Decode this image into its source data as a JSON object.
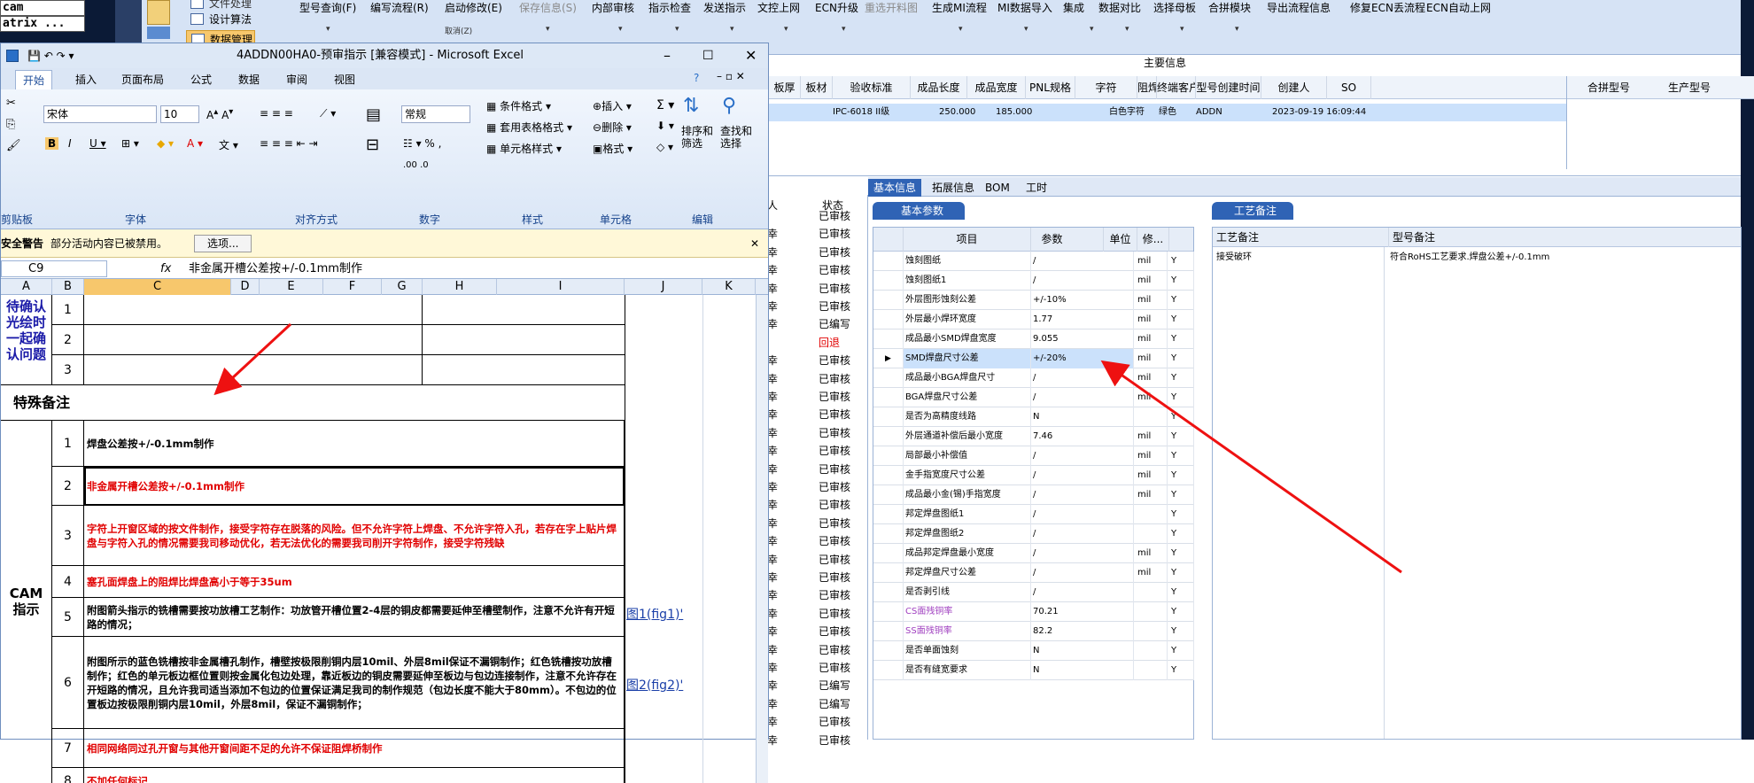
{
  "topleft": {
    "line1": "cam",
    "line2": "atrix ..."
  },
  "erp_left": {
    "top_label": "文件处理",
    "btn1": "设计算法",
    "btn2": "数据管理"
  },
  "erp_menu": [
    {
      "label": "型号查询(F)",
      "dd": "▾"
    },
    {
      "label": "编写流程(R)",
      "dd": ""
    },
    {
      "label": "启动修改(E)",
      "dd": "取消(Z)"
    },
    {
      "label": "保存信息(S)",
      "dd": "▾",
      "disabled": true
    },
    {
      "label": "内部审核",
      "dd": "▾"
    },
    {
      "label": "指示检查",
      "dd": "▾"
    },
    {
      "label": "发送指示",
      "dd": "▾"
    },
    {
      "label": "文控上网",
      "dd": "▾"
    },
    {
      "label": "ECN升级",
      "dd": "▾"
    },
    {
      "label": "重选开料图",
      "dd": "",
      "disabled": true
    },
    {
      "label": "生成MI流程",
      "dd": "▾"
    },
    {
      "label": "MI数据导入",
      "dd": "▾"
    },
    {
      "label": "集成",
      "dd": "▾"
    },
    {
      "label": "数据对比",
      "dd": "▾"
    },
    {
      "label": "选择母板",
      "dd": "▾"
    },
    {
      "label": "合拼模块",
      "dd": "▾"
    },
    {
      "label": "导出流程信息",
      "dd": ""
    },
    {
      "label": "修复ECN丢流程",
      "dd": ""
    },
    {
      "label": "ECN自动上网",
      "dd": ""
    }
  ],
  "main_info": {
    "title": "主要信息"
  },
  "grid": {
    "headers": [
      "板厚",
      "板材",
      "验收标准",
      "成品长度",
      "成品宽度",
      "PNL规格",
      "字符",
      "阻焊",
      "终端客户代码",
      "型号创建时间",
      "创建人",
      "SO"
    ],
    "row": {
      "std": "IPC-6018 II级",
      "len": "250.000",
      "wid": "185.000",
      "char": "白色字符",
      "mask": "绿色",
      "code": "ADDN",
      "time": "2023-09-19 16:09:44"
    },
    "right_headers": [
      "合拼型号",
      "生产型号"
    ]
  },
  "tabs": [
    "基本信息",
    "拓展信息",
    "BOM",
    "工时"
  ],
  "basic_params_tab": "基本参数",
  "process_notes_tab": "工艺备注",
  "params_table": {
    "headers": [
      "项目",
      "参数",
      "单位",
      "修..."
    ],
    "rows": [
      {
        "name": "蚀刻图纸",
        "val": "/",
        "unit": "mil",
        "y": "Y"
      },
      {
        "name": "蚀刻图纸1",
        "val": "/",
        "unit": "mil",
        "y": "Y"
      },
      {
        "name": "外层图形蚀刻公差",
        "val": "+/-10%",
        "unit": "mil",
        "y": "Y"
      },
      {
        "name": "外层最小焊环宽度",
        "val": "1.77",
        "unit": "mil",
        "y": "Y"
      },
      {
        "name": "成品最小SMD焊盘宽度",
        "val": "9.055",
        "unit": "mil",
        "y": "Y"
      },
      {
        "name": "SMD焊盘尺寸公差",
        "val": "+/-20%",
        "unit": "mil",
        "y": "Y",
        "selected": true
      },
      {
        "name": "成品最小BGA焊盘尺寸",
        "val": "/",
        "unit": "mil",
        "y": "Y"
      },
      {
        "name": "BGA焊盘尺寸公差",
        "val": "/",
        "unit": "mil",
        "y": "Y"
      },
      {
        "name": "是否为高精度线路",
        "val": "N",
        "unit": "",
        "y": "Y"
      },
      {
        "name": "外层通道补偿后最小宽度",
        "val": "7.46",
        "unit": "mil",
        "y": "Y"
      },
      {
        "name": "局部最小补偿值",
        "val": "/",
        "unit": "mil",
        "y": "Y"
      },
      {
        "name": "金手指宽度尺寸公差",
        "val": "/",
        "unit": "mil",
        "y": "Y"
      },
      {
        "name": "成品最小金(锡)手指宽度",
        "val": "/",
        "unit": "mil",
        "y": "Y"
      },
      {
        "name": "邦定焊盘图纸1",
        "val": "/",
        "unit": "",
        "y": "Y"
      },
      {
        "name": "邦定焊盘图纸2",
        "val": "/",
        "unit": "",
        "y": "Y"
      },
      {
        "name": "成品邦定焊盘最小宽度",
        "val": "/",
        "unit": "mil",
        "y": "Y"
      },
      {
        "name": "邦定焊盘尺寸公差",
        "val": "/",
        "unit": "mil",
        "y": "Y"
      },
      {
        "name": "是否剥引线",
        "val": "/",
        "unit": "",
        "y": "Y"
      },
      {
        "name": "CS面残铜率",
        "val": "70.21",
        "unit": "",
        "y": "Y",
        "purple": true
      },
      {
        "name": "SS面残铜率",
        "val": "82.2",
        "unit": "",
        "y": "Y",
        "purple": true
      },
      {
        "name": "是否单面蚀刻",
        "val": "N",
        "unit": "",
        "y": "Y"
      },
      {
        "name": "是否有缝宽要求",
        "val": "N",
        "unit": "",
        "y": "Y"
      }
    ]
  },
  "notes_table": {
    "h1": "工艺备注",
    "h2": "型号备注",
    "v1": "接受破环",
    "v2": "符合RoHS工艺要求.焊盘公差+/-0.1mm"
  },
  "mid_list": {
    "h1": "人",
    "h2": "状态",
    "rows": [
      {
        "a": "",
        "b": "已审核"
      },
      {
        "a": "幸",
        "b": "已审核"
      },
      {
        "a": "幸",
        "b": "已审核"
      },
      {
        "a": "幸",
        "b": "已审核"
      },
      {
        "a": "幸",
        "b": "已审核"
      },
      {
        "a": "幸",
        "b": "已审核"
      },
      {
        "a": "幸",
        "b": "已编写"
      },
      {
        "a": "",
        "b": "回退",
        "red": true
      },
      {
        "a": "幸",
        "b": "已审核"
      },
      {
        "a": "幸",
        "b": "已审核"
      },
      {
        "a": "幸",
        "b": "已审核"
      },
      {
        "a": "幸",
        "b": "已审核"
      },
      {
        "a": "幸",
        "b": "已审核"
      },
      {
        "a": "幸",
        "b": "已审核"
      },
      {
        "a": "幸",
        "b": "已审核"
      },
      {
        "a": "幸",
        "b": "已审核"
      },
      {
        "a": "幸",
        "b": "已审核"
      },
      {
        "a": "幸",
        "b": "已审核"
      },
      {
        "a": "幸",
        "b": "已审核"
      },
      {
        "a": "幸",
        "b": "已审核"
      },
      {
        "a": "幸",
        "b": "已审核"
      },
      {
        "a": "幸",
        "b": "已审核"
      },
      {
        "a": "幸",
        "b": "已审核"
      },
      {
        "a": "幸",
        "b": "已审核"
      },
      {
        "a": "幸",
        "b": "已审核"
      },
      {
        "a": "幸",
        "b": "已审核"
      },
      {
        "a": "幸",
        "b": "已编写"
      },
      {
        "a": "幸",
        "b": "已编写"
      },
      {
        "a": "幸",
        "b": "已审核"
      },
      {
        "a": "幸",
        "b": "已审核"
      }
    ]
  },
  "excel": {
    "title": "4ADDN00HA0-预审指示 [兼容模式] - Microsoft Excel",
    "tabs": [
      "开始",
      "插入",
      "页面布局",
      "公式",
      "数据",
      "审阅",
      "视图"
    ],
    "font": "宋体",
    "size": "10",
    "numfmt": "常规",
    "groups": [
      "剪贴板",
      "字体",
      "对齐方式",
      "数字",
      "样式",
      "单元格",
      "编辑"
    ],
    "styles": [
      "条件格式",
      "套用表格格式",
      "单元格样式"
    ],
    "cells": [
      "插入",
      "删除",
      "格式"
    ],
    "edit": [
      "排序和\n筛选",
      "查找和\n选择"
    ],
    "security_label": "安全警告",
    "security_msg": "部分活动内容已被禁用。",
    "options_btn": "选项...",
    "namebox": "C9",
    "formula": "非金属开槽公差按+/-0.1mm制作",
    "cols": [
      "A",
      "B",
      "C",
      "D",
      "E",
      "F",
      "G",
      "H",
      "I",
      "J",
      "K"
    ],
    "side_confirm": "待确认光绘时一起确认问题",
    "special_note": "特殊备注",
    "cam_label": "CAM 指示",
    "link1": "图1(fig1)'",
    "link2": "图2(fig2)'",
    "rows": [
      {
        "n": "1",
        "text": "焊盘公差按+/-0.1mm制作",
        "red": false
      },
      {
        "n": "2",
        "text": "非金属开槽公差按+/-0.1mm制作",
        "red": true
      },
      {
        "n": "3",
        "text": "字符上开窗区域的按文件制作，接受字符存在脱落的风险。但不允许字符上焊盘、不允许字符入孔，若存在字上贴片焊盘与字符入孔的情况需要我司移动优化，若无法优化的需要我司削开字符制作，接受字符残缺",
        "red": true
      },
      {
        "n": "4",
        "text": "塞孔面焊盘上的阻焊比焊盘高小于等于35um",
        "red": true
      },
      {
        "n": "5",
        "text": "附图箭头指示的铣槽需要按功放槽工艺制作：功放管开槽位置2-4层的铜皮都需要延伸至槽壁制作，注意不允许有开短路的情况；",
        "red": false
      },
      {
        "n": "6",
        "text": "附图所示的蓝色铣槽按非金属槽孔制作，槽壁按极限削铜内层10mil、外层8mil保证不漏铜制作；红色铣槽按功放槽制作；红色的单元板边框位置则按金属化包边处理，靠近板边的铜皮需要延伸至板边与包边连接制作，注意不允许存在开短路的情况，且允许我司适当添加不包边的位置保证满足我司的制作规范（包边长度不能大于80mm）。不包边的位置板边按极限削铜内层10mil，外层8mil，保证不漏铜制作；",
        "red": false
      },
      {
        "n": "7",
        "text": "相同网络同过孔开窗与其他开窗间距不足的允许不保证阻焊桥制作",
        "red": true
      },
      {
        "n": "8",
        "text": "不加任何标记",
        "red": true
      }
    ]
  }
}
